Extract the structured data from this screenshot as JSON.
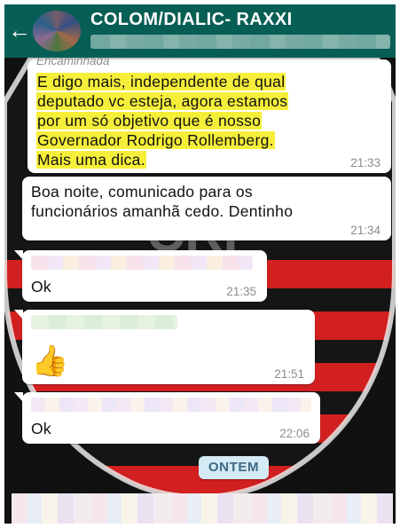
{
  "header": {
    "title": "COLOM/DIALIC- RAXXI",
    "back_icon": "arrow-left-icon"
  },
  "messages": [
    {
      "forwarded_label": "Encaminhada",
      "lines": [
        "E digo mais, independente de qual",
        "deputado vc esteja, agora estamos",
        "por um só objetivo que é nosso",
        "Governador Rodrigo Rollemberg.",
        "Mais uma dica."
      ],
      "highlight_color": "#f6ef3a",
      "time": "21:33"
    },
    {
      "lines": [
        "Boa noite, comunicado para os",
        "funcionários amanhã cedo. Dentinho"
      ],
      "time": "21:34"
    },
    {
      "text": "Ok",
      "time": "21:35"
    },
    {
      "emoji": "👍",
      "emoji_name": "thumbs-up-icon",
      "time": "21:51"
    },
    {
      "text": "Ok",
      "time": "22:06"
    }
  ],
  "date_separator": "ONTEM",
  "colors": {
    "header": "#075e54",
    "bubble": "#ffffff",
    "date_pill": "#d4eaf4",
    "emblem_red": "#d21f1f",
    "emblem_black": "#111111"
  }
}
